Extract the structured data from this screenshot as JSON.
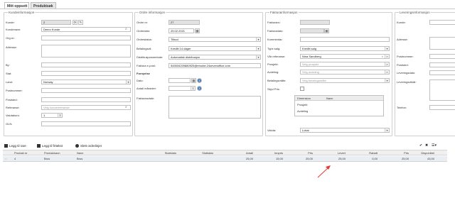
{
  "tabs": [
    {
      "label": "Mitt oppsett",
      "active": true
    },
    {
      "label": "Produktsøk",
      "active": false
    }
  ],
  "kunde": {
    "legend": "Kundeinformasjon",
    "fields": [
      {
        "label": "Kunde:",
        "value": "2"
      },
      {
        "label": "Kundenavn:",
        "value": "Demo Kunde"
      },
      {
        "label": "Org.nr.:",
        "value": ""
      },
      {
        "label": "Adresse:",
        "value": ""
      },
      {
        "label": "By:",
        "value": ""
      },
      {
        "label": "Stat:",
        "value": ""
      },
      {
        "label": "Land:",
        "value": "Norway"
      },
      {
        "label": "Postnummer:",
        "value": ""
      },
      {
        "label": "Poststed:",
        "value": ""
      },
      {
        "label": "Referanse:",
        "placeholder": "Velg kundereferanse"
      },
      {
        "label": "Valutakurs:",
        "value": "1"
      },
      {
        "label": "GLN:",
        "value": ""
      }
    ]
  },
  "ordre": {
    "legend": "Ordre informasjon",
    "fields": [
      {
        "label": "Ordre nr:",
        "value": "27"
      },
      {
        "label": "Ordredato:",
        "value": "25.02.2021"
      },
      {
        "label": "Ordrestatus:",
        "value": "Tilbud"
      },
      {
        "label": "Betalingsvil:",
        "value": "Kreditt 14 dager"
      },
      {
        "label": "Distribusjonsmetode:",
        "value": "Automatisk distribusjon"
      },
      {
        "label": "Faktura e-post:",
        "value": "545534209880925@ehoder.24sevenoffice.com"
      },
      {
        "label": "Fornyelse",
        "value": ""
      },
      {
        "label": "Dato:",
        "value": ""
      },
      {
        "label": "Antall måneder:",
        "value": ""
      },
      {
        "label": "Faktureavtale:",
        "value": ""
      }
    ]
  },
  "faktura": {
    "legend": "Fakturainformasjon",
    "fields": [
      {
        "label": "Fakturanr.:",
        "value": ""
      },
      {
        "label": "Fakturadato:",
        "value": ""
      },
      {
        "label": "Kommentar:",
        "value": ""
      },
      {
        "label": "Type salg:",
        "value": "Kreditt salg"
      },
      {
        "label": "Vår referanse:",
        "value": "Nina Sandberg"
      },
      {
        "label": "Prosjekt:",
        "placeholder": "Velg prosjekt"
      },
      {
        "label": "Avdeling:",
        "placeholder": "Velg avdeling"
      },
      {
        "label": "Betalingsmåte:",
        "placeholder": "Velg betalingsmåte"
      },
      {
        "label": "Skjul Pris:",
        "value": ""
      },
      {
        "label": "Valuta:",
        "value": "Lokal"
      }
    ],
    "dim_table": {
      "headers": [
        "Dimension",
        "Navn"
      ],
      "rows": [
        "Prosjekt",
        "Avdeling"
      ]
    }
  },
  "levering": {
    "legend": "Leveringsinformasjon",
    "fields": [
      {
        "label": "Kunde:"
      },
      {
        "label": "Adresse:"
      },
      {
        "label": "Postnummer:"
      },
      {
        "label": "Poststed:"
      },
      {
        "label": "Leveringsdato:"
      },
      {
        "label": "Leveringsvilkår:"
      },
      {
        "label": "Telefon:"
      }
    ]
  },
  "toolbar": {
    "add_row": "Legg til rare",
    "add_text": "Legg til fritekst",
    "delete": "Slett ordrelinjer"
  },
  "order_grid": {
    "headers": [
      "Produkt nr",
      "Produktnavn",
      "Navn",
      "Startdato",
      "Sluttdato",
      "Antall",
      "Innpris",
      "Pris",
      "Levert",
      "Rabatt",
      "Pris",
      "Disponibel"
    ],
    "rows": [
      [
        "4",
        "Brus",
        "Brus",
        "",
        "",
        "25,00",
        "15,00",
        "25,00",
        "25,00",
        "0,00",
        "25,00",
        "43,00"
      ]
    ]
  },
  "colors": {
    "annotation_arrow": "#e53935",
    "row_highlight": "#e9eef4"
  }
}
